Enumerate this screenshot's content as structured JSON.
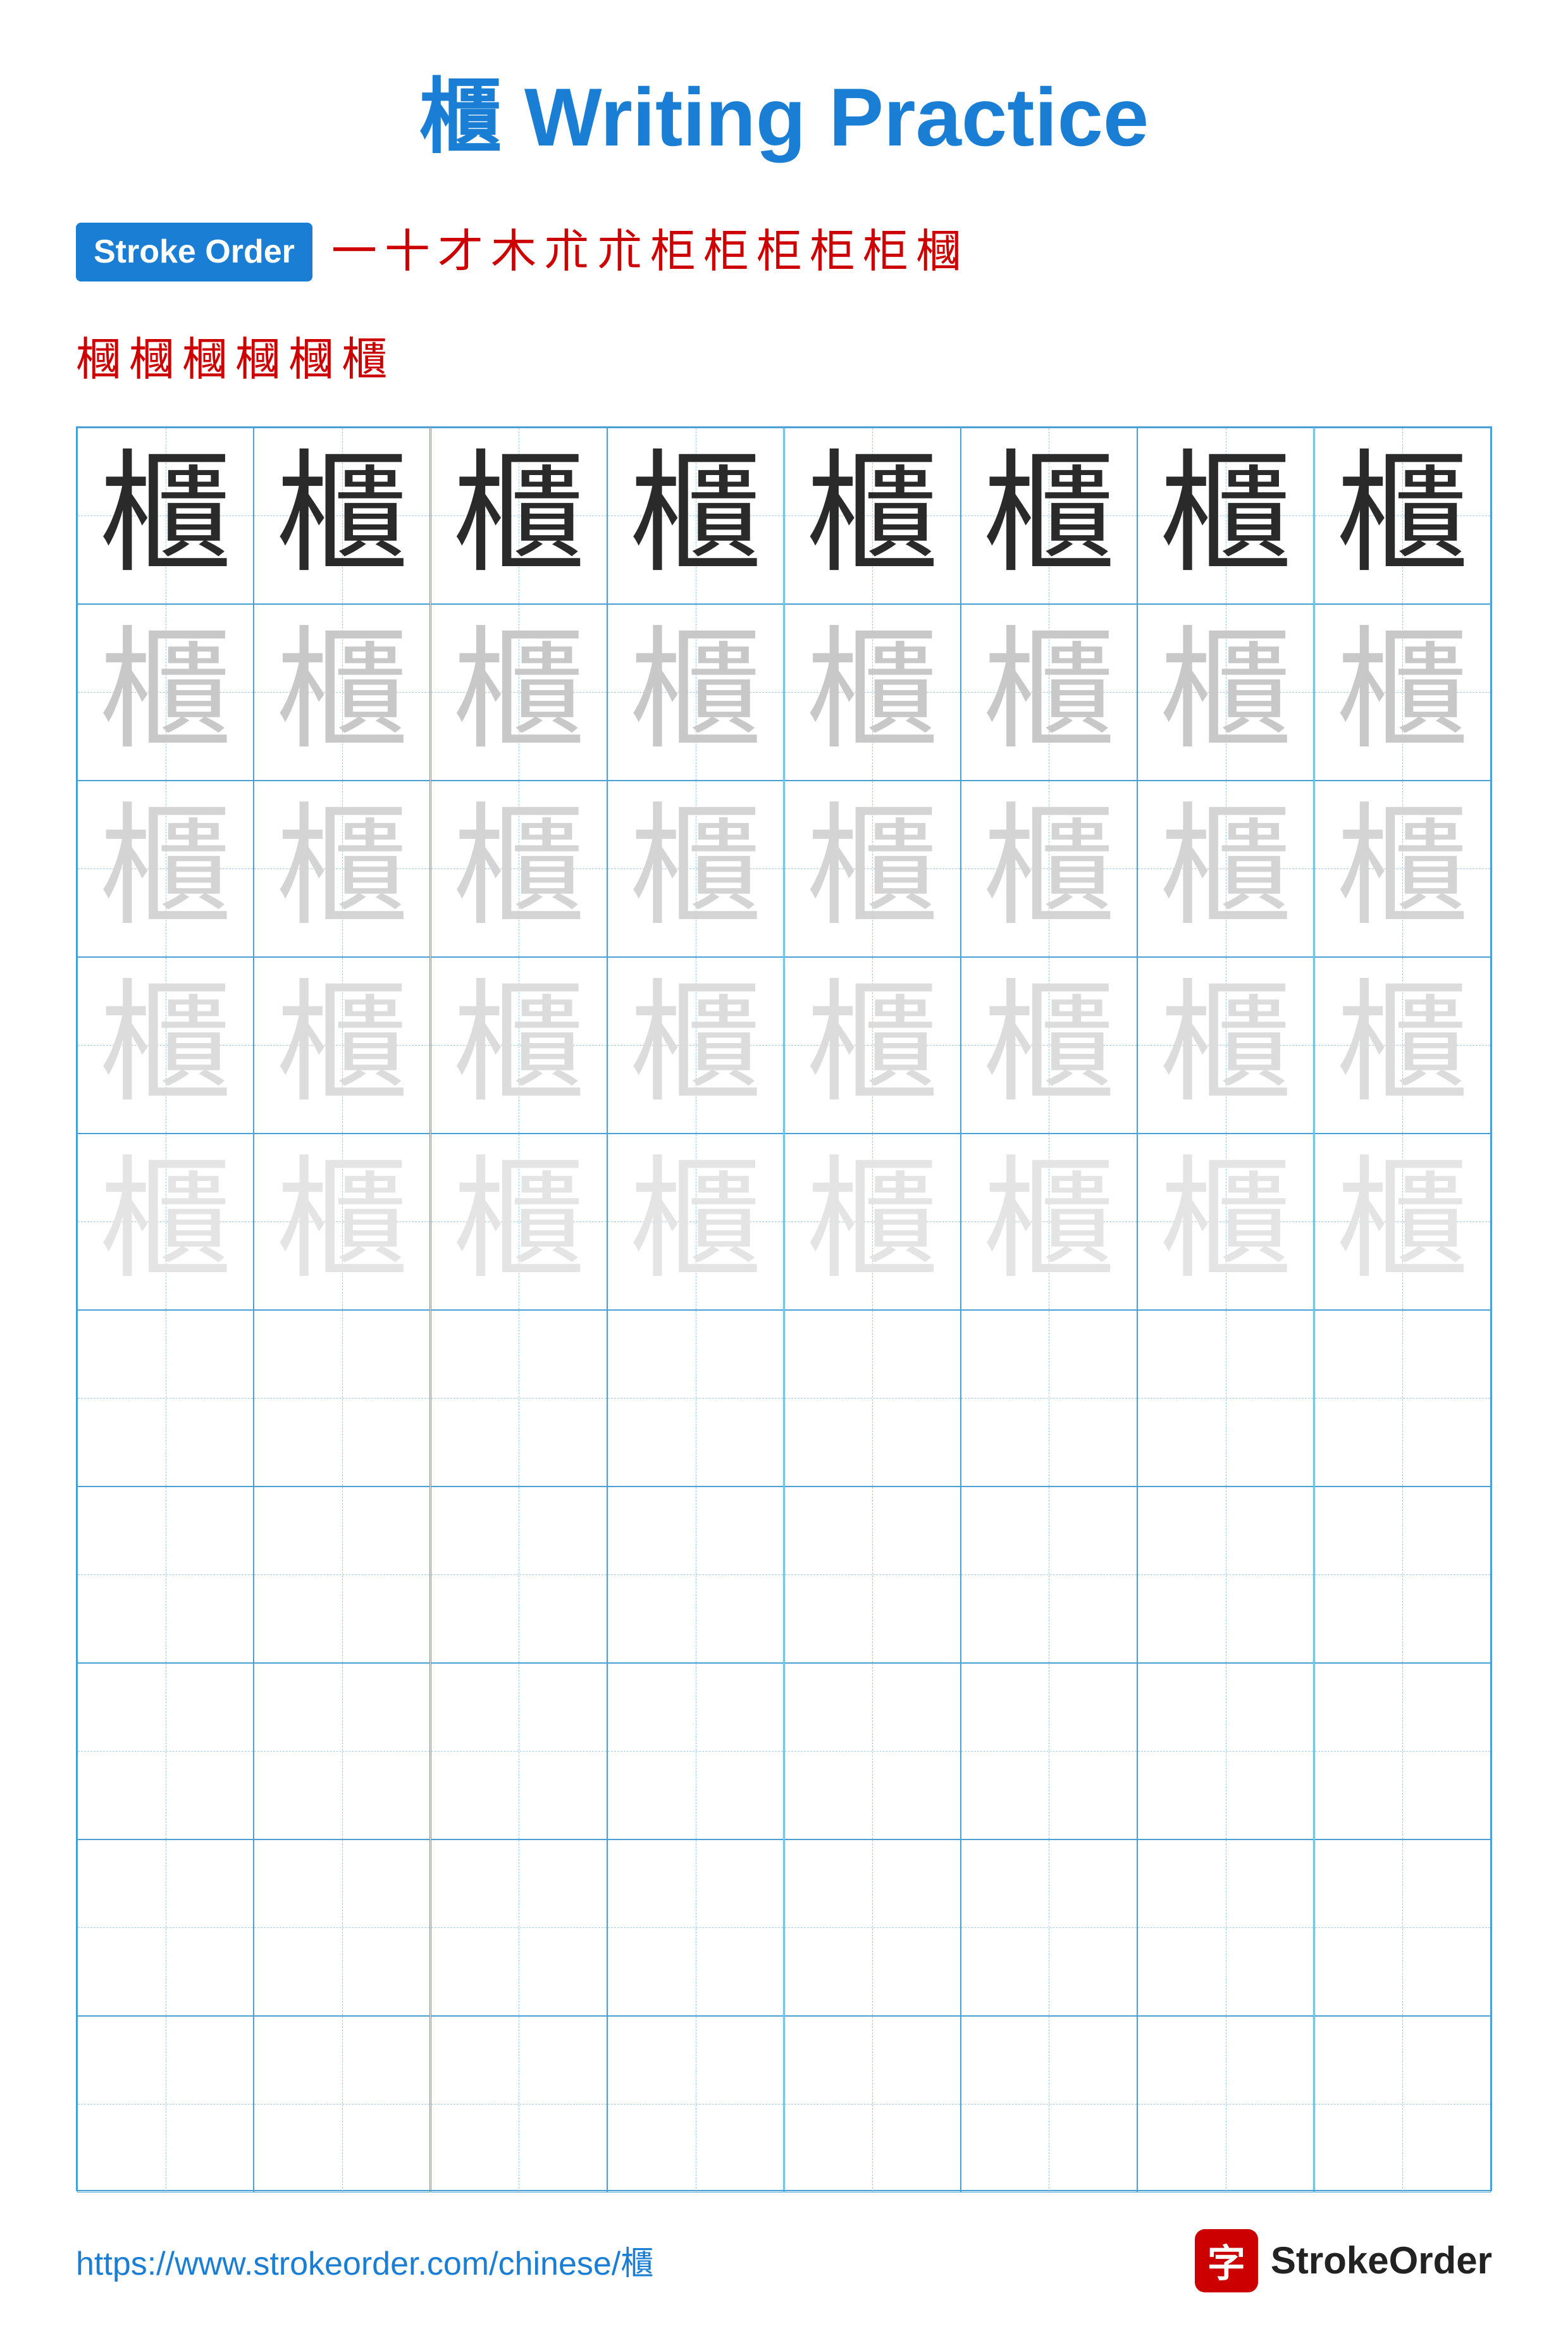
{
  "title": {
    "char": "櫃",
    "text": " Writing Practice"
  },
  "stroke_order": {
    "badge_label": "Stroke Order",
    "strokes_line1": [
      "一",
      "十",
      "才",
      "木",
      "朮",
      "朮",
      "柜",
      "柜",
      "柜",
      "柜",
      "柜",
      "槶"
    ],
    "strokes_line2": [
      "槶",
      "槶",
      "槶",
      "槶",
      "槶",
      "櫃"
    ]
  },
  "grid": {
    "cols": 8,
    "rows": 10,
    "char": "櫃",
    "filled_rows": 5
  },
  "footer": {
    "url": "https://www.strokeorder.com/chinese/櫃",
    "logo_char": "字",
    "logo_text": "StrokeOrder"
  }
}
